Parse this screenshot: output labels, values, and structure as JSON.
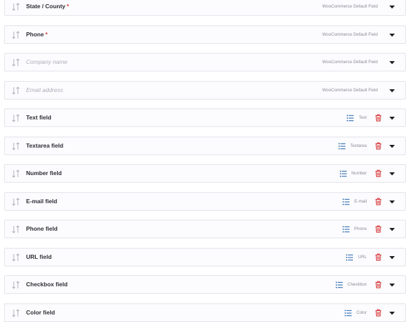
{
  "fields": [
    {
      "label": "State / County",
      "required": true,
      "placeholder": false,
      "type": "WooCommerce Default Field",
      "default": true
    },
    {
      "label": "Phone",
      "required": true,
      "placeholder": false,
      "type": "WooCommerce Default Field",
      "default": true
    },
    {
      "label": "Company name",
      "required": false,
      "placeholder": true,
      "type": "WooCommerce Default Field",
      "default": true
    },
    {
      "label": "Email address",
      "required": false,
      "placeholder": true,
      "type": "WooCommerce Default Field",
      "default": true
    },
    {
      "label": "Text field",
      "required": false,
      "placeholder": false,
      "type": "Text",
      "default": false
    },
    {
      "label": "Textarea field",
      "required": false,
      "placeholder": false,
      "type": "Textarea",
      "default": false
    },
    {
      "label": "Number field",
      "required": false,
      "placeholder": false,
      "type": "Number",
      "default": false
    },
    {
      "label": "E-mail field",
      "required": false,
      "placeholder": false,
      "type": "E-mail",
      "default": false
    },
    {
      "label": "Phone field",
      "required": false,
      "placeholder": false,
      "type": "Phone",
      "default": false
    },
    {
      "label": "URL field",
      "required": false,
      "placeholder": false,
      "type": "URL",
      "default": false
    },
    {
      "label": "Checkbox field",
      "required": false,
      "placeholder": false,
      "type": "Checkbox",
      "default": false
    },
    {
      "label": "Color field",
      "required": false,
      "placeholder": false,
      "type": "Color",
      "default": false
    }
  ],
  "required_marker": "*",
  "icons": {
    "handle": "sort-arrows-icon",
    "type": "list-icon",
    "delete": "trash-icon",
    "toggle": "caret-down-icon"
  },
  "colors": {
    "list_icon": "#2b6cb0",
    "trash": "#d63638",
    "required": "#d63638"
  }
}
